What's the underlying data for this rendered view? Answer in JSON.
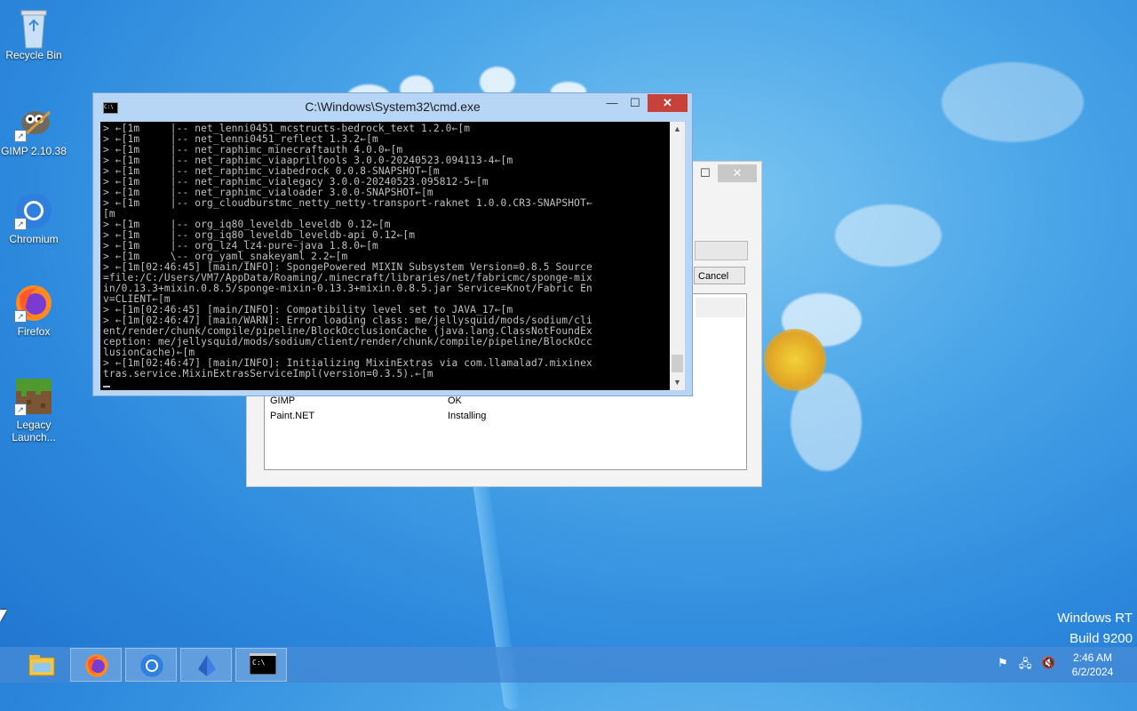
{
  "desktop": {
    "icons": [
      {
        "label": "Recycle Bin",
        "icon": "recycle-bin-icon"
      },
      {
        "label": "GIMP 2.10.38",
        "icon": "gimp-icon"
      },
      {
        "label": "Chromium",
        "icon": "chromium-icon"
      },
      {
        "label": "Firefox",
        "icon": "firefox-icon"
      },
      {
        "label": "Legacy Launch...",
        "icon": "minecraft-grass-block-icon"
      }
    ]
  },
  "cmd_window": {
    "title": "C:\\Windows\\System32\\cmd.exe",
    "buttons": {
      "minimize": "—",
      "maximize": "☐",
      "close": "✕"
    },
    "console_text": "> ←[1m     |-- net_lenni0451_mcstructs-bedrock_text 1.2.0←[m\n> ←[1m     |-- net_lenni0451_reflect 1.3.2←[m\n> ←[1m     |-- net_raphimc_minecraftauth 4.0.0←[m\n> ←[1m     |-- net_raphimc_viaaprilfools 3.0.0-20240523.094113-4←[m\n> ←[1m     |-- net_raphimc_viabedrock 0.0.8-SNAPSHOT←[m\n> ←[1m     |-- net_raphimc_vialegacy 3.0.0-20240523.095812-5←[m\n> ←[1m     |-- net_raphimc_vialoader 3.0.0-SNAPSHOT←[m\n> ←[1m     |-- org_cloudburstmc_netty_netty-transport-raknet 1.0.0.CR3-SNAPSHOT←\n[m\n> ←[1m     |-- org_iq80_leveldb_leveldb 0.12←[m\n> ←[1m     |-- org_iq80_leveldb_leveldb-api 0.12←[m\n> ←[1m     |-- org_lz4_lz4-pure-java 1.8.0←[m\n> ←[1m     \\-- org_yaml_snakeyaml 2.2←[m\n> ←[1m[02:46:45] [main/INFO]: SpongePowered MIXIN Subsystem Version=0.8.5 Source\n=file:/C:/Users/VM7/AppData/Roaming/.minecraft/libraries/net/fabricmc/sponge-mix\nin/0.13.3+mixin.0.8.5/sponge-mixin-0.13.3+mixin.0.8.5.jar Service=Knot/Fabric En\nv=CLIENT←[m\n> ←[1m[02:46:45] [main/INFO]: Compatibility level set to JAVA_17←[m\n> ←[1m[02:46:47] [main/WARN]: Error loading class: me/jellysquid/mods/sodium/cli\nent/render/chunk/compile/pipeline/BlockOcclusionCache (java.lang.ClassNotFoundEx\nception: me/jellysquid/mods/sodium/client/render/chunk/compile/pipeline/BlockOcc\nlusionCache)←[m\n> ←[1m[02:46:47] [main/INFO]: Initializing MixinExtras via com.llamalad7.mixinex\ntras.service.MixinExtrasServiceImpl(version=0.3.5).←[m"
  },
  "installer_dialog": {
    "cancel_label": "Cancel",
    "rows": [
      {
        "name": "GIMP",
        "status": "OK"
      },
      {
        "name": "Paint.NET",
        "status": "Installing"
      }
    ]
  },
  "watermark": {
    "line1": "Windows RT",
    "line2": "Build 9200"
  },
  "taskbar": {
    "apps": [
      "file-explorer-icon",
      "firefox-icon",
      "chromium-icon",
      "app-crystal-icon",
      "cmd-icon"
    ],
    "clock_time": "2:46 AM",
    "clock_date": "6/2/2024"
  }
}
